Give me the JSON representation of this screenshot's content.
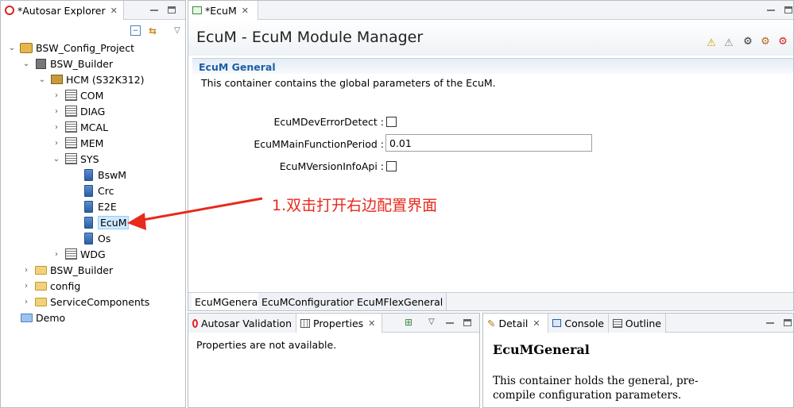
{
  "explorer": {
    "tab_title": "*Autosar Explorer",
    "tree": [
      {
        "label": "BSW_Config_Project"
      },
      {
        "label": "BSW_Builder"
      },
      {
        "label": "HCM (S32K312)"
      },
      {
        "label": "COM"
      },
      {
        "label": "DIAG"
      },
      {
        "label": "MCAL"
      },
      {
        "label": "MEM"
      },
      {
        "label": "SYS"
      },
      {
        "label": "BswM"
      },
      {
        "label": "Crc"
      },
      {
        "label": "E2E"
      },
      {
        "label": "EcuM"
      },
      {
        "label": "Os"
      },
      {
        "label": "WDG"
      },
      {
        "label": "BSW_Builder"
      },
      {
        "label": "config"
      },
      {
        "label": "ServiceComponents"
      },
      {
        "label": "Demo"
      }
    ]
  },
  "editor": {
    "tab_title": "*EcuM",
    "title": "EcuM - EcuM Module Manager",
    "section_title": "EcuM General",
    "description": "This container contains the global parameters of the EcuM.",
    "fields": {
      "dev_error_label": "EcuMDevErrorDetect :",
      "main_function_label": "EcuMMainFunctionPeriod :",
      "main_function_value": "0.01",
      "version_info_label": "EcuMVersionInfoApi :"
    },
    "bottom_tabs": [
      "EcuMGeneral",
      "EcuMConfiguration",
      "EcuMFlexGeneral"
    ]
  },
  "props_panel": {
    "tab_validation": "Autosar Validation",
    "tab_properties": "Properties",
    "message": "Properties are not available."
  },
  "detail_panel": {
    "tab_detail": "Detail",
    "tab_console": "Console",
    "tab_outline": "Outline",
    "heading": "EcuMGeneral",
    "body": "This container holds the general, pre-compile configuration parameters."
  },
  "annotation": {
    "text": "1.双击打开右边配置界面",
    "color": "#e8291d"
  }
}
